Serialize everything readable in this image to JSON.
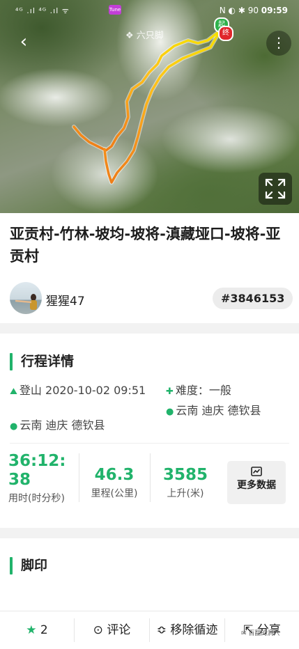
{
  "status_bar": {
    "left_signals": "⁴ᴳ .ıl ⁴ᴳ .ıl ᯤ",
    "app_badge": "Tune",
    "right_icons": "N ◐ ✱ 90",
    "time": "09:59"
  },
  "map": {
    "logo": "六只脚",
    "start_label": "起",
    "end_label": "终",
    "route_colors": [
      "#f6e200",
      "#ffb020",
      "#f08a18"
    ]
  },
  "route": {
    "title": "亚贡村-竹林-坡均-坡将-滇藏垭口-坡将-亚贡村",
    "user_name": "猩猩47",
    "track_id": "#3846153"
  },
  "details": {
    "section_title": "行程详情",
    "activity_type": "登山",
    "start_datetime": "2020-10-02 09:51",
    "start_location": "云南 迪庆 德钦县",
    "difficulty": "难度：一般",
    "end_location": "云南 迪庆 德钦县",
    "stats": [
      {
        "value": "36:12:38",
        "label": "用时(时分秒)"
      },
      {
        "value": "46.3",
        "label": "里程(公里)"
      },
      {
        "value": "3585",
        "label": "上升(米)"
      }
    ],
    "more_data_label": "更多数据"
  },
  "footprint": {
    "section_title": "脚印"
  },
  "bottom_bar": {
    "like_count": "2",
    "comment_label": "评论",
    "remove_track_label": "移除循迹",
    "share_label": "分享",
    "watermark": "百翻的洞穴"
  },
  "colors": {
    "accent_green": "#21b36b",
    "start_pin": "#2fb24c",
    "end_pin": "#e0262b"
  }
}
